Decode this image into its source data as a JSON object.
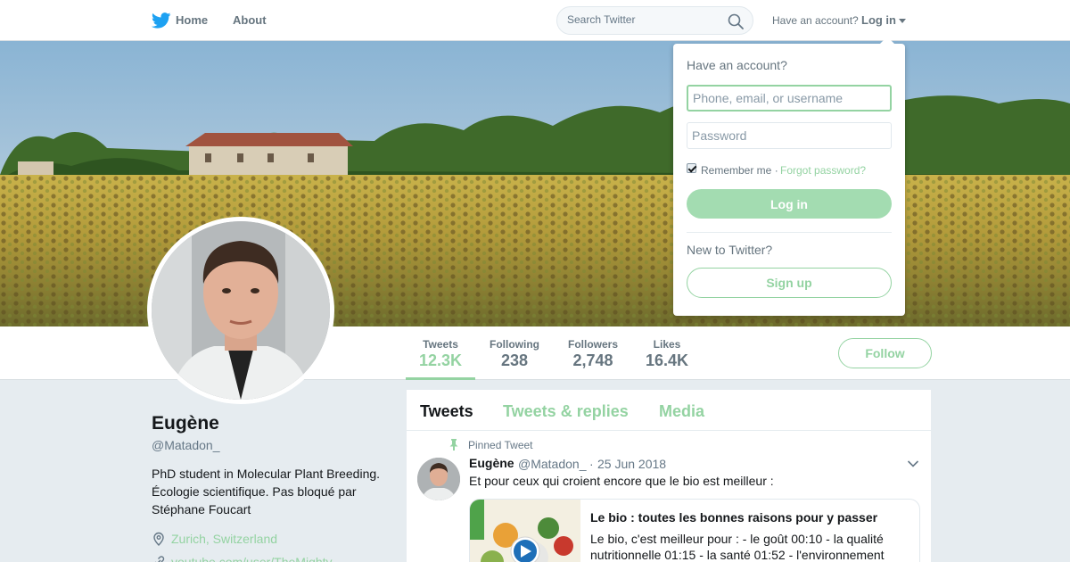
{
  "nav": {
    "home_label": "Home",
    "about_label": "About",
    "search_placeholder": "Search Twitter",
    "have_account_label": "Have an account?",
    "login_label": "Log in",
    "icons": [
      "twitter-bird-icon",
      "search-icon",
      "caret-down-icon"
    ]
  },
  "profile": {
    "name": "Eugène",
    "handle": "@Matadon_",
    "bio": "PhD student in Molecular Plant Breeding. Écologie scientifique. Pas bloqué par Stéphane Foucart",
    "location": "Zurich, Switzerland",
    "url": "youtube.com/user/TheMighty..."
  },
  "stats": [
    {
      "label": "Tweets",
      "value": "12.3K"
    },
    {
      "label": "Following",
      "value": "238"
    },
    {
      "label": "Followers",
      "value": "2,748"
    },
    {
      "label": "Likes",
      "value": "16.4K"
    }
  ],
  "follow_label": "Follow",
  "timeline": {
    "tabs": [
      "Tweets",
      "Tweets & replies",
      "Media"
    ],
    "pinned_label": "Pinned Tweet",
    "tweet": {
      "name": "Eugène",
      "handle": "@Matadon_",
      "separator": "·",
      "date": "25 Jun 2018",
      "text": "Et pour ceux qui croient encore que le bio est meilleur :",
      "card_title": "Le bio : toutes les bonnes raisons pour y passer",
      "card_description": "Le bio, c'est meilleur pour : - le goût 00:10 - la qualité nutritionnelle 01:15 - la santé 01:52 - l'environnement"
    }
  },
  "login_dropdown": {
    "heading": "Have an account?",
    "username_placeholder": "Phone, email, or username",
    "password_placeholder": "Password",
    "remember_label": "Remember me ·",
    "forgot_label": "Forgot password?",
    "login_button": "Log in",
    "new_label": "New to Twitter?",
    "signup_button": "Sign up"
  },
  "colors": {
    "accent": "#94d3a2",
    "twitter_blue": "#1da1f2",
    "text_secondary": "#657786",
    "page_bg": "#e6ecf0"
  }
}
